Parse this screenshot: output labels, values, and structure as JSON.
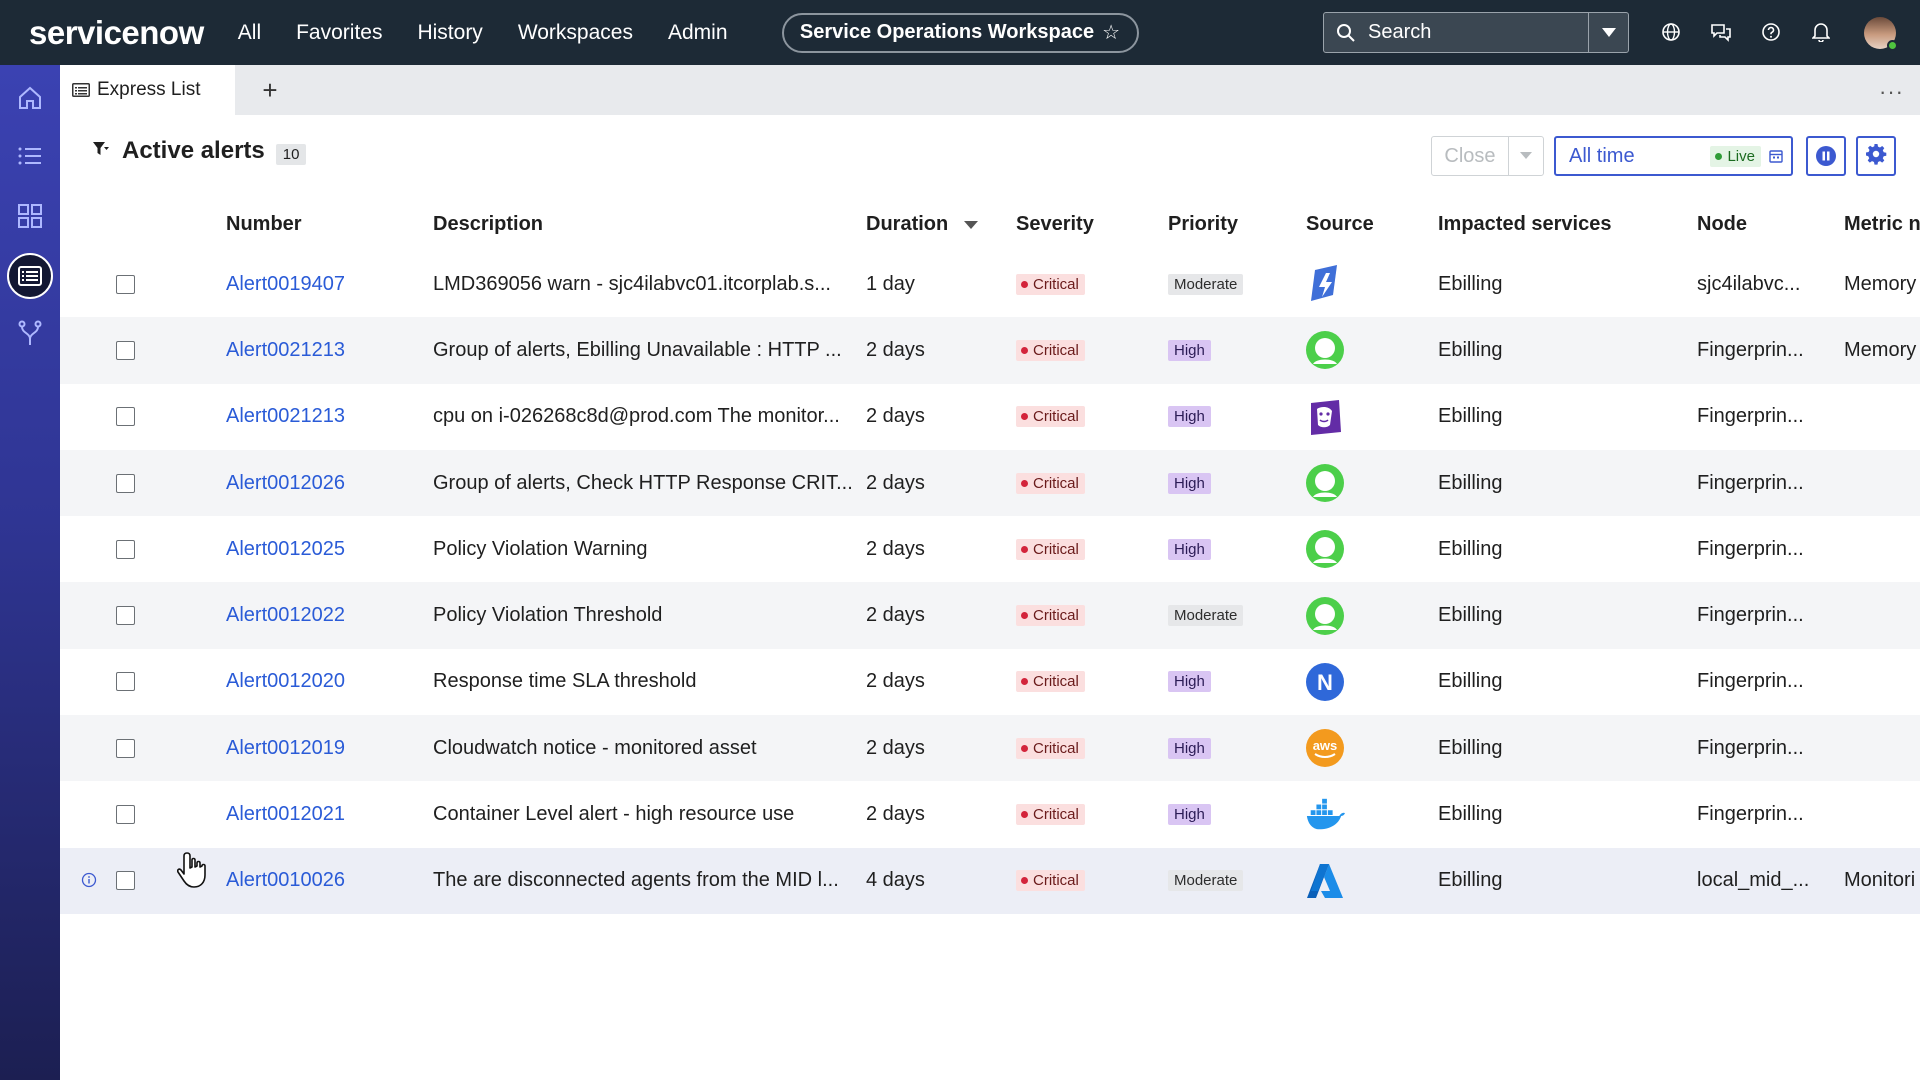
{
  "topbar": {
    "logo_text": "servicenow",
    "nav": [
      "All",
      "Favorites",
      "History",
      "Workspaces",
      "Admin"
    ],
    "workspace": "Service Operations Workspace",
    "search_placeholder": "Search",
    "icons": [
      "globe-icon",
      "chat-icon",
      "help-icon",
      "bell-icon"
    ]
  },
  "rail": {
    "items": [
      "home-icon",
      "list-icon",
      "grid-icon",
      "express-list-icon",
      "branch-icon"
    ]
  },
  "tabs": {
    "active_label": "Express List",
    "add": "+",
    "more": "···"
  },
  "header": {
    "title": "Active alerts",
    "count": "10",
    "close_label": "Close",
    "time_label": "All time",
    "live_label": "Live"
  },
  "columns": [
    "Number",
    "Description",
    "Duration",
    "Severity",
    "Priority",
    "Source",
    "Impacted services",
    "Node",
    "Metric n"
  ],
  "rows": [
    {
      "number": "Alert0019407",
      "description": "LMD369056 warn - sjc4ilabvc01.itcorplab.s...",
      "duration": "1 day",
      "severity": "Critical",
      "priority": "Moderate",
      "source": "source-logo-bolt",
      "service": "Ebilling",
      "node": "sjc4ilabvc...",
      "metric": "Memory"
    },
    {
      "number": "Alert0021213",
      "description": "Group of alerts, Ebilling Unavailable : HTTP ...",
      "duration": "2 days",
      "severity": "Critical",
      "priority": "High",
      "source": "source-logo-ring",
      "service": "Ebilling",
      "node": "Fingerprin...",
      "metric": "Memory"
    },
    {
      "number": "Alert0021213",
      "description": "cpu on i-026268c8d@prod.com The monitor...",
      "duration": "2 days",
      "severity": "Critical",
      "priority": "High",
      "source": "source-logo-dog",
      "service": "Ebilling",
      "node": "Fingerprin...",
      "metric": ""
    },
    {
      "number": "Alert0012026",
      "description": "Group of alerts, Check HTTP Response CRIT...",
      "duration": "2 days",
      "severity": "Critical",
      "priority": "High",
      "source": "source-logo-ring",
      "service": "Ebilling",
      "node": "Fingerprin...",
      "metric": ""
    },
    {
      "number": "Alert0012025",
      "description": "Policy Violation Warning",
      "duration": "2 days",
      "severity": "Critical",
      "priority": "High",
      "source": "source-logo-ring",
      "service": "Ebilling",
      "node": "Fingerprin...",
      "metric": ""
    },
    {
      "number": "Alert0012022",
      "description": "Policy Violation Threshold",
      "duration": "2 days",
      "severity": "Critical",
      "priority": "Moderate",
      "source": "source-logo-ring",
      "service": "Ebilling",
      "node": "Fingerprin...",
      "metric": ""
    },
    {
      "number": "Alert0012020",
      "description": "Response time SLA threshold",
      "duration": "2 days",
      "severity": "Critical",
      "priority": "High",
      "source": "source-logo-n",
      "service": "Ebilling",
      "node": "Fingerprin...",
      "metric": ""
    },
    {
      "number": "Alert0012019",
      "description": "Cloudwatch notice - monitored asset",
      "duration": "2 days",
      "severity": "Critical",
      "priority": "High",
      "source": "source-logo-aws",
      "service": "Ebilling",
      "node": "Fingerprin...",
      "metric": ""
    },
    {
      "number": "Alert0012021",
      "description": "Container Level alert - high resource use",
      "duration": "2 days",
      "severity": "Critical",
      "priority": "High",
      "source": "source-logo-docker",
      "service": "Ebilling",
      "node": "Fingerprin...",
      "metric": ""
    },
    {
      "number": "Alert0010026",
      "description": "The are disconnected agents from the MID l...",
      "duration": "4 days",
      "severity": "Critical",
      "priority": "Moderate",
      "source": "source-logo-azure",
      "service": "Ebilling",
      "node": "local_mid_...",
      "metric": "Monitori"
    }
  ],
  "aws_text": "aws",
  "n_text": "N",
  "colors": {
    "link": "#2a5bd7",
    "accent": "#3c59d0",
    "critical": "#d3243b",
    "high": "#d9c5f3",
    "topbar": "#1d2a36"
  }
}
